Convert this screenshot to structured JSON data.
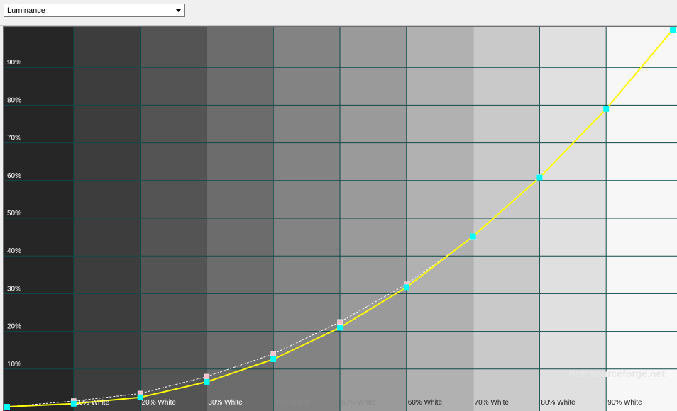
{
  "toolbar": {
    "mode_select": {
      "value": "Luminance"
    }
  },
  "watermark": "hcfr.sourceforge.net",
  "colors": {
    "measured_line": "#ffff00",
    "measured_marker": "#00ffff",
    "reference_line": "#ffffff",
    "reference_marker": "#ffc0cb",
    "grid": "#0e4a4a",
    "axis_text": "#ffffff"
  },
  "chart_data": {
    "type": "line",
    "x": [
      0,
      10,
      20,
      30,
      40,
      50,
      60,
      70,
      80,
      90,
      100
    ],
    "x_tick_labels": [
      "",
      "10% White",
      "20% White",
      "30% White",
      "40% White",
      "50% White",
      "60% White",
      "70% White",
      "80% White",
      "90% White",
      ""
    ],
    "y_tick_labels": [
      "10%",
      "20%",
      "30%",
      "40%",
      "50%",
      "60%",
      "70%",
      "80%",
      "90%"
    ],
    "y_ticks": [
      10,
      20,
      30,
      40,
      50,
      60,
      70,
      80,
      90
    ],
    "xlim": [
      0,
      100
    ],
    "ylim": [
      0,
      100
    ],
    "grid": true,
    "background": "gray-ramp",
    "series": [
      {
        "role": "reference",
        "style": "dashed",
        "values": [
          0,
          1.5,
          3.5,
          8,
          14,
          22.5,
          32.5,
          45,
          61,
          79,
          100
        ]
      },
      {
        "role": "measured",
        "style": "solid",
        "values": [
          0,
          0.8,
          2.5,
          6.6,
          12.6,
          21.0,
          31.7,
          45.2,
          60.8,
          79.0,
          100
        ]
      }
    ]
  }
}
